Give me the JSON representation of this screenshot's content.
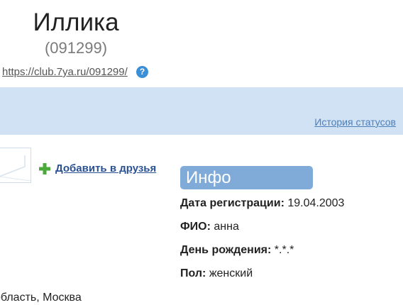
{
  "profile": {
    "name": "Иллика",
    "id": "(091299)",
    "link": "https://club.7ya.ru/091299/",
    "help_icon": "?"
  },
  "status": {
    "history_link": "История статусов"
  },
  "actions": {
    "add_friend": "Добавить в друзья",
    "add_icon": "plus-icon",
    "accent_color": "#4aa93a"
  },
  "info": {
    "title": "Инфо",
    "rows": [
      {
        "label": "Дата регистрации:",
        "value": "19.04.2003"
      },
      {
        "label": "ФИО:",
        "value": "анна"
      },
      {
        "label": "День рождения:",
        "value": "*.*.*"
      },
      {
        "label": "Пол:",
        "value": "женский"
      }
    ]
  },
  "location": "область, Москва"
}
